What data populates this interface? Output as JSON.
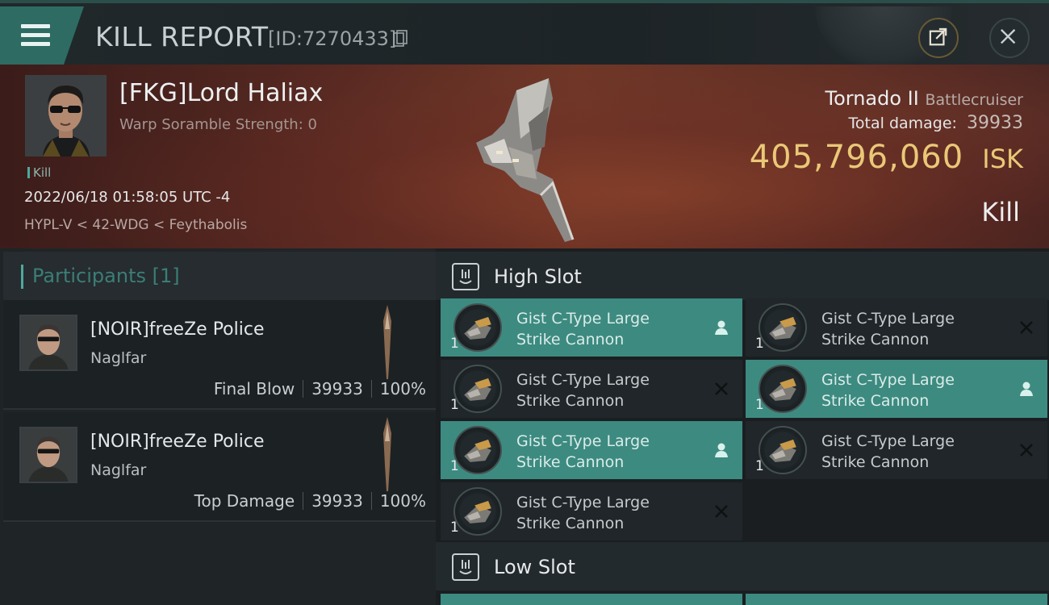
{
  "header": {
    "title": "KILL REPORT",
    "report_id": "[ID:7270433]"
  },
  "victim": {
    "name": "[FKG]Lord Haliax",
    "scramble": "Warp Soramble Strength: 0",
    "tag": "Kill",
    "timestamp": "2022/06/18 01:58:05 UTC -4",
    "location": "HYPL-V < 42-WDG < Feythabolis",
    "ship_name": "Tornado II",
    "ship_class": "Battlecruiser",
    "damage_label": "Total damage:",
    "damage_value": "39933",
    "isk_value": "405,796,060",
    "isk_unit": "ISK",
    "result": "Kill"
  },
  "participants": {
    "title": "Participants [1]",
    "rows": [
      {
        "name": "[NOIR]freeZe Police",
        "ship": "Naglfar",
        "role": "Final Blow",
        "damage": "39933",
        "percent": "100%"
      },
      {
        "name": "[NOIR]freeZe Police",
        "ship": "Naglfar",
        "role": "Top Damage",
        "damage": "39933",
        "percent": "100%"
      }
    ]
  },
  "slots": {
    "high_title": "High Slot",
    "low_title": "Low Slot",
    "modules": [
      {
        "line1": "Gist C-Type Large",
        "line2": "Strike Cannon",
        "qty": "1",
        "status": "fitted"
      },
      {
        "line1": "Gist C-Type Large",
        "line2": "Strike Cannon",
        "qty": "1",
        "status": "destroyed"
      },
      {
        "line1": "Gist C-Type Large",
        "line2": "Strike Cannon",
        "qty": "1",
        "status": "destroyed"
      },
      {
        "line1": "Gist C-Type Large",
        "line2": "Strike Cannon",
        "qty": "1",
        "status": "fitted"
      },
      {
        "line1": "Gist C-Type Large",
        "line2": "Strike Cannon",
        "qty": "1",
        "status": "fitted"
      },
      {
        "line1": "Gist C-Type Large",
        "line2": "Strike Cannon",
        "qty": "1",
        "status": "destroyed"
      },
      {
        "line1": "Gist C-Type Large",
        "line2": "Strike Cannon",
        "qty": "1",
        "status": "destroyed"
      }
    ]
  },
  "icons": {
    "menu": "hamburger-menu-icon",
    "copy": "copy-icon",
    "share": "share-icon",
    "close": "close-icon",
    "fitted": "person-icon",
    "destroyed": "x-icon"
  },
  "colors": {
    "accent": "#3d8a80",
    "isk": "#eac877"
  }
}
